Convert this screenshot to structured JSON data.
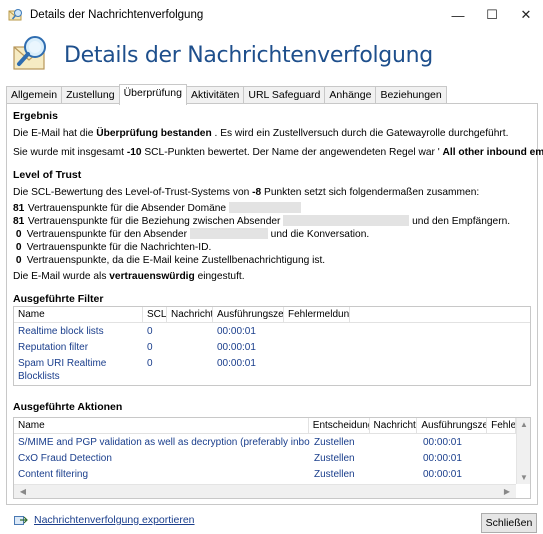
{
  "window": {
    "title": "Details der Nachrichtenverfolgung",
    "minimize": "—",
    "maximize": "☐",
    "close": "✕"
  },
  "header": {
    "heading": "Details der Nachrichtenverfolgung"
  },
  "tabs": [
    "Allgemein",
    "Zustellung",
    "Überprüfung",
    "Aktivitäten",
    "URL Safeguard",
    "Anhänge",
    "Beziehungen"
  ],
  "active_tab": "Überprüfung",
  "ergebnis": {
    "title": "Ergebnis",
    "line1_pre": "Die E-Mail hat die ",
    "line1_bold": "Überprüfung bestanden",
    "line1_post": " . Es wird ein Zustellversuch durch die Gatewayrolle durchgeführt.",
    "line2_pre": "Sie wurde mit insgesamt ",
    "line2_bold": "-10",
    "line2_mid": " SCL-Punkten bewertet.  Der Name der angewendeten Regel war ' ",
    "line2_bold2": "All other inbound emails",
    "line2_post": " '."
  },
  "trust": {
    "title": "Level of Trust",
    "intro_pre": "Die SCL-Bewertung des Level-of-Trust-Systems von ",
    "intro_bold": "-8",
    "intro_post": " Punkten setzt sich folgendermaßen zusammen:",
    "items": [
      {
        "points": "81",
        "text": "Vertrauenspunkte für die Absender Domäne",
        "text2": ""
      },
      {
        "points": "81",
        "text": "Vertrauenspunkte für die Beziehung zwischen Absender",
        "text2": "und den Empfängern."
      },
      {
        "points": "0",
        "text": "Vertrauenspunkte für den Absender",
        "text2": "und die Konversation."
      },
      {
        "points": "0",
        "text": "Vertrauenspunkte für die Nachrichten-ID.",
        "text2": ""
      },
      {
        "points": "0",
        "text": "Vertrauenspunkte, da die E-Mail keine Zustellbenachrichtigung ist.",
        "text2": ""
      }
    ],
    "verdict_pre": "Die E-Mail wurde als ",
    "verdict_bold": "vertrauenswürdig",
    "verdict_post": " eingestuft."
  },
  "filters": {
    "title": "Ausgeführte Filter",
    "columns": [
      "Name",
      "SCL",
      "Nachricht",
      "Ausführungszeit",
      "Fehlermeldung"
    ],
    "rows": [
      {
        "name": "Realtime block lists",
        "scl": "0",
        "time": "00:00:01"
      },
      {
        "name": "Reputation filter",
        "scl": "0",
        "time": "00:00:01"
      },
      {
        "name": "Spam URI Realtime Blocklists",
        "scl": "0",
        "time": "00:00:01"
      }
    ]
  },
  "actions": {
    "title": "Ausgeführte Aktionen",
    "columns": [
      "Name",
      "Entscheidung",
      "Nachricht",
      "Ausführungszeit",
      "Fehlerme"
    ],
    "rows": [
      {
        "name": "S/MIME and PGP validation as well as decryption (preferably inbound)",
        "decision": "Zustellen",
        "time": "00:00:01"
      },
      {
        "name": "CxO Fraud Detection",
        "decision": "Zustellen",
        "time": "00:00:01"
      },
      {
        "name": "Content filtering",
        "decision": "Zustellen",
        "time": "00:00:01"
      }
    ]
  },
  "footer": {
    "export_link": "Nachrichtenverfolgung exportieren",
    "close_button": "Schließen"
  }
}
